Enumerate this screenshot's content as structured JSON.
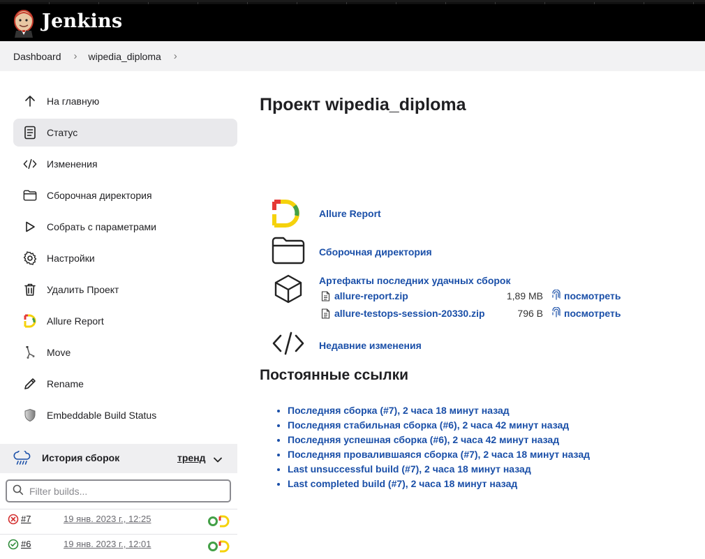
{
  "header": {
    "brand": "Jenkins"
  },
  "breadcrumb": {
    "items": [
      "Dashboard",
      "wipedia_diploma"
    ]
  },
  "sidebar": {
    "items": [
      {
        "label": "На главную",
        "icon": "arrow-up-icon"
      },
      {
        "label": "Статус",
        "icon": "document-icon",
        "active": true
      },
      {
        "label": "Изменения",
        "icon": "code-icon"
      },
      {
        "label": "Сборочная директория",
        "icon": "folder-icon"
      },
      {
        "label": "Собрать с параметрами",
        "icon": "play-icon"
      },
      {
        "label": "Настройки",
        "icon": "gear-icon"
      },
      {
        "label": "Удалить Проект",
        "icon": "trash-icon"
      },
      {
        "label": "Allure Report",
        "icon": "allure-icon"
      },
      {
        "label": "Move",
        "icon": "move-icon"
      },
      {
        "label": "Rename",
        "icon": "pencil-icon"
      },
      {
        "label": "Embeddable Build Status",
        "icon": "shield-icon"
      }
    ]
  },
  "history": {
    "title": "История сборок",
    "trend": "тренд",
    "filter_placeholder": "Filter builds...",
    "builds": [
      {
        "number": "#7",
        "date": "19 янв. 2023 г., 12:25",
        "status": "failed"
      },
      {
        "number": "#6",
        "date": "19 янв. 2023 г., 12:01",
        "status": "success"
      }
    ]
  },
  "main": {
    "title": "Проект wipedia_diploma",
    "allure_link": "Allure Report",
    "workspace_link": "Сборочная директория",
    "artifacts_title": "Артефакты последних удачных сборок",
    "artifacts": [
      {
        "name": "allure-report.zip",
        "size": "1,89 MB",
        "view": "посмотреть"
      },
      {
        "name": "allure-testops-session-20330.zip",
        "size": "796 B",
        "view": "посмотреть"
      }
    ],
    "changes_link": "Недавние изменения",
    "permalinks_title": "Постоянные ссылки",
    "permalinks": [
      "Последняя сборка (#7), 2 часа 18 минут назад",
      "Последняя стабильная сборка (#6), 2 часа 42 минут назад",
      "Последняя успешная сборка (#6), 2 часа 42 минут назад",
      "Последняя провалившаяся сборка (#7), 2 часа 18 минут назад",
      "Last unsuccessful build (#7), 2 часа 18 минут назад",
      "Last completed build (#7), 2 часа 18 минут назад"
    ]
  },
  "colors": {
    "link": "#1a4fa8",
    "header_bg": "#000000",
    "breadcrumb_bg": "#f2f2f3",
    "active_item_bg": "#e9e9ec"
  }
}
